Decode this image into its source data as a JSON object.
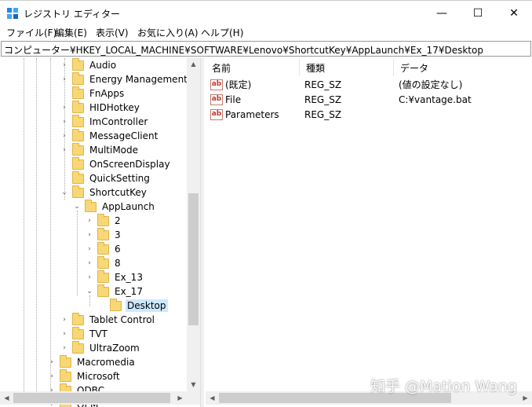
{
  "window": {
    "title": "レジストリ エディター",
    "minimize_glyph": "—",
    "maximize_glyph": "☐",
    "close_glyph": "✕",
    "icon": "registry-editor-icon"
  },
  "menu": {
    "items": [
      "ファイル(F)",
      "編集(E)",
      "表示(V)",
      "お気に入り(A)",
      "ヘルプ(H)"
    ]
  },
  "address": {
    "path": "コンピューター¥HKEY_LOCAL_MACHINE¥SOFTWARE¥Lenovo¥ShortcutKey¥AppLaunch¥Ex_17¥Desktop"
  },
  "tree": {
    "items": [
      {
        "label": "Audio",
        "expander": "›"
      },
      {
        "label": "Energy Management",
        "expander": "›"
      },
      {
        "label": "FnApps",
        "expander": ""
      },
      {
        "label": "HIDHotkey",
        "expander": "›"
      },
      {
        "label": "ImController",
        "expander": "›"
      },
      {
        "label": "MessageClient",
        "expander": "›"
      },
      {
        "label": "MultiMode",
        "expander": "›"
      },
      {
        "label": "OnScreenDisplay",
        "expander": ""
      },
      {
        "label": "QuickSetting",
        "expander": ""
      },
      {
        "label": "ShortcutKey",
        "expander": "⌄"
      },
      {
        "label": "AppLaunch",
        "expander": "⌄"
      },
      {
        "label": "2",
        "expander": "›"
      },
      {
        "label": "3",
        "expander": "›"
      },
      {
        "label": "6",
        "expander": "›"
      },
      {
        "label": "8",
        "expander": "›"
      },
      {
        "label": "Ex_13",
        "expander": "›"
      },
      {
        "label": "Ex_17",
        "expander": "⌄"
      },
      {
        "label": "Desktop",
        "expander": "",
        "selected": true
      },
      {
        "label": "Tablet Control",
        "expander": "›"
      },
      {
        "label": "TVT",
        "expander": "›"
      },
      {
        "label": "UltraZoom",
        "expander": "›"
      },
      {
        "label": "Macromedia",
        "expander": "›"
      },
      {
        "label": "Microsoft",
        "expander": "›"
      },
      {
        "label": "ODBC",
        "expander": "›"
      },
      {
        "label": "OEM",
        "expander": "›"
      }
    ]
  },
  "list": {
    "columns": {
      "name": "名前",
      "type": "種類",
      "data": "データ"
    },
    "rows": [
      {
        "name": "(既定)",
        "type": "REG_SZ",
        "data": "(値の設定なし)",
        "icon": "ab"
      },
      {
        "name": "File",
        "type": "REG_SZ",
        "data": "C:¥vantage.bat",
        "icon": "ab"
      },
      {
        "name": "Parameters",
        "type": "REG_SZ",
        "data": "",
        "icon": "ab"
      }
    ]
  },
  "scroll": {
    "up": "▲",
    "down": "▼",
    "left": "◀",
    "right": "▶"
  },
  "watermark": "知乎 @Mation Wang",
  "colors": {
    "selection": "#cce8ff",
    "folder": "#f8d775",
    "scrollbar_track": "#f0f0f0",
    "scrollbar_thumb": "#cdcdcd"
  }
}
